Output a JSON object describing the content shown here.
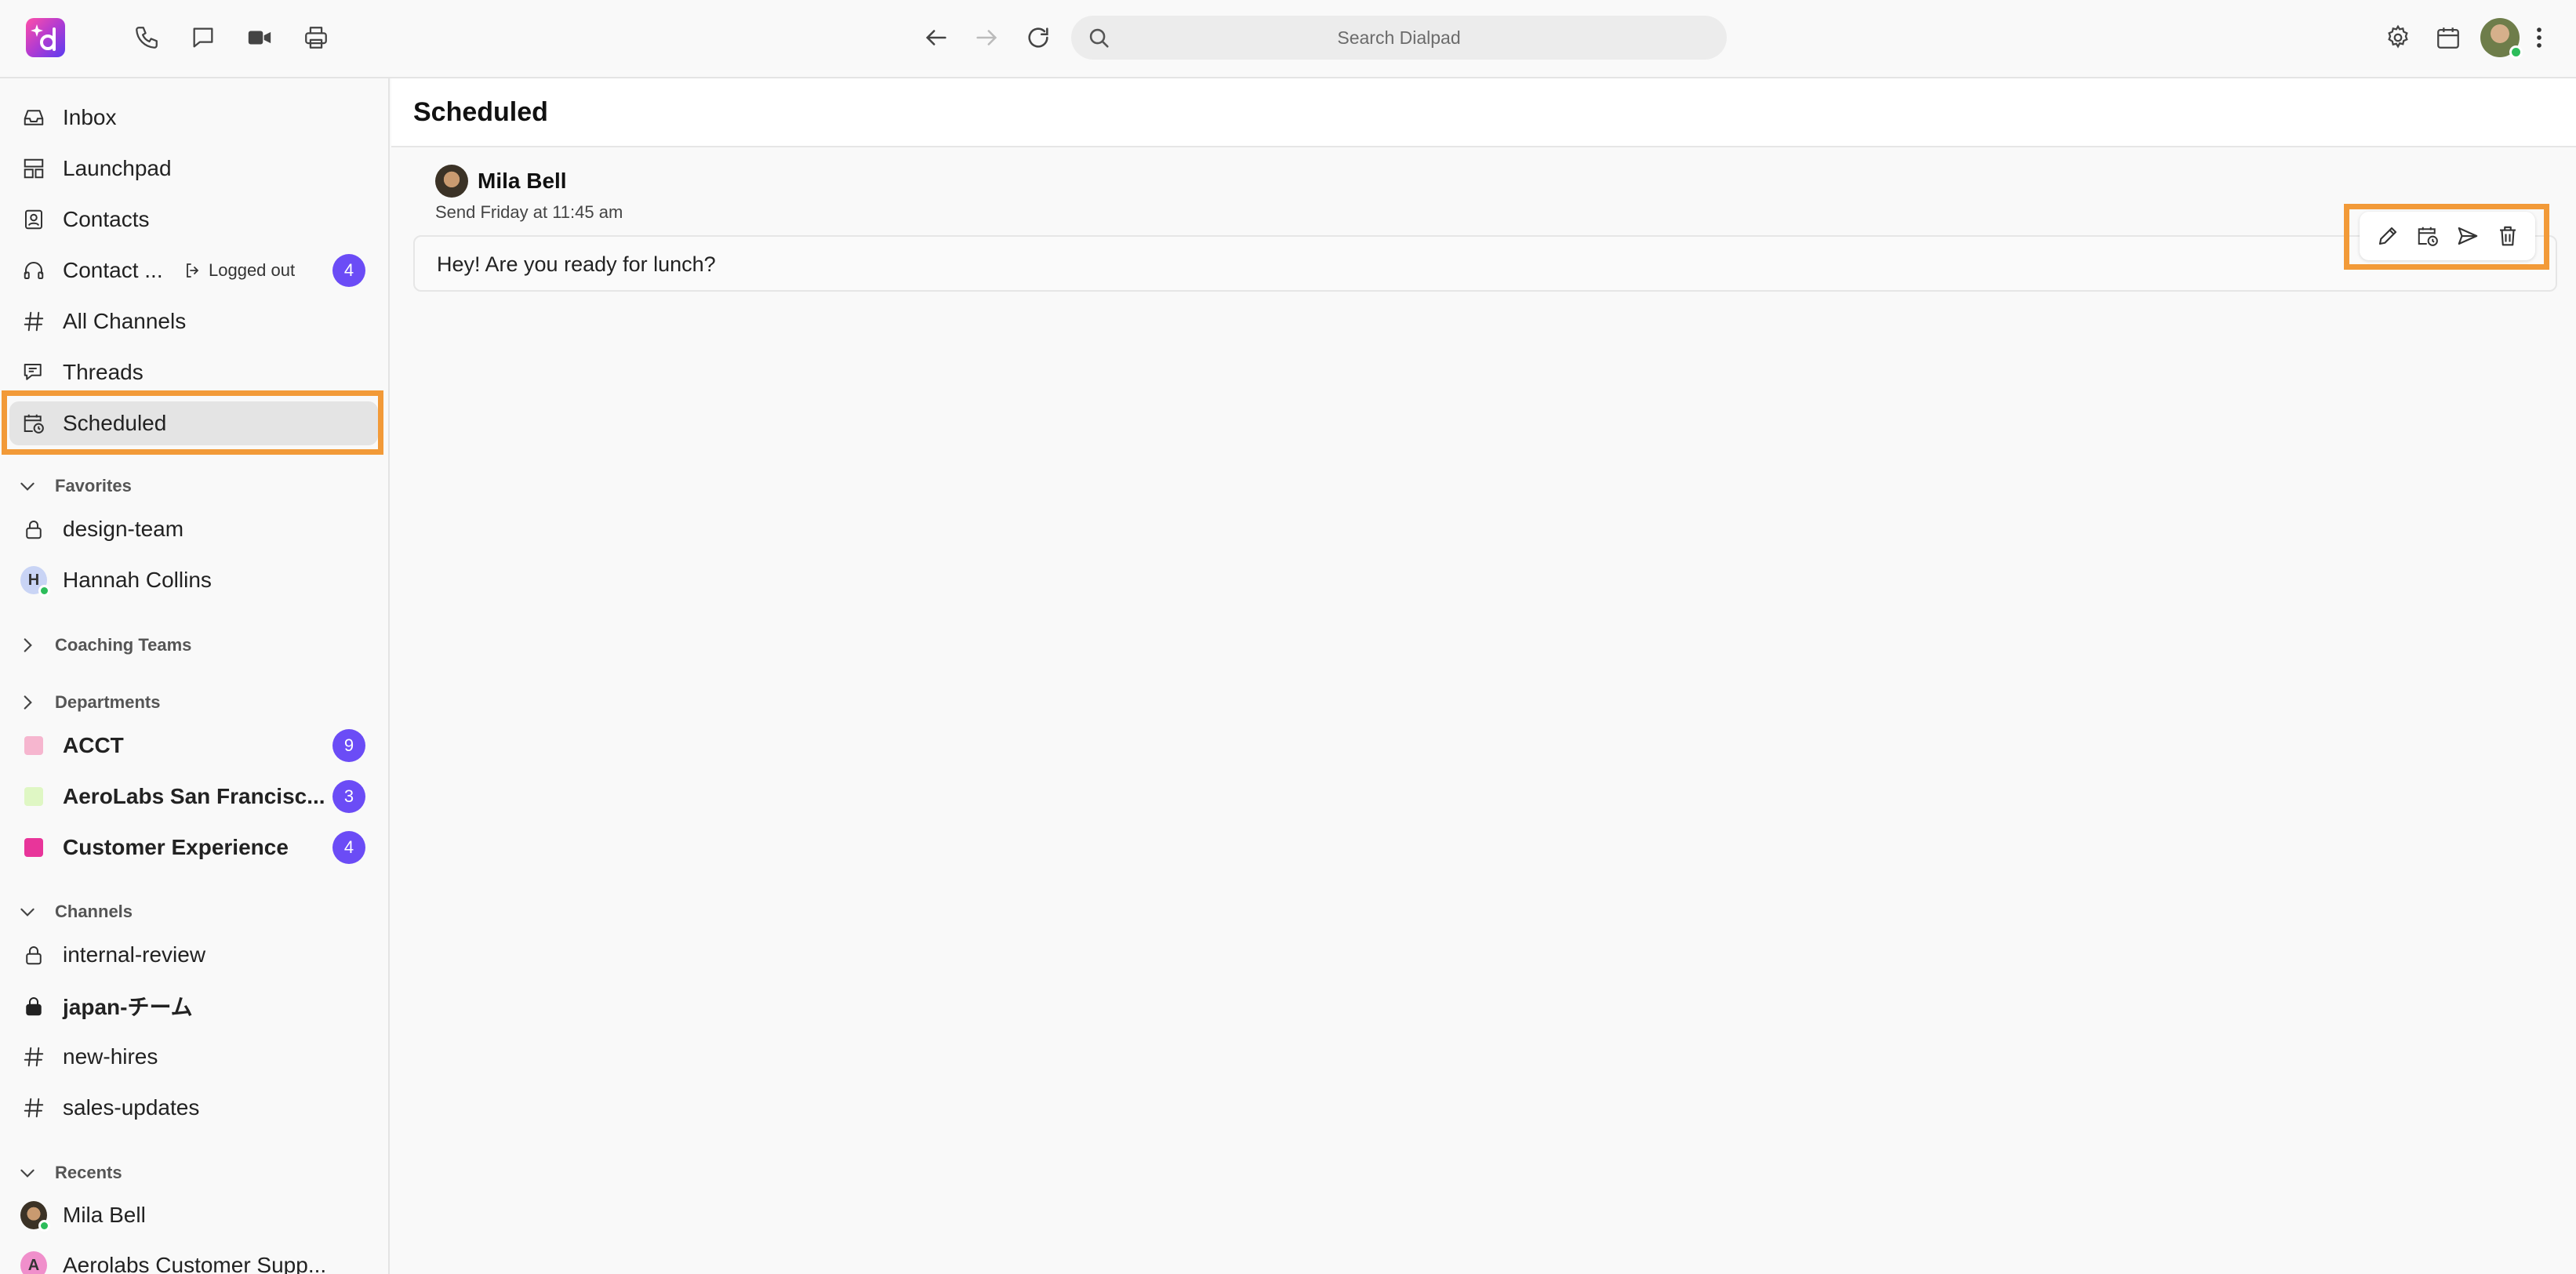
{
  "search": {
    "placeholder": "Search Dialpad"
  },
  "sidebar": {
    "items": [
      {
        "label": "Inbox"
      },
      {
        "label": "Launchpad"
      },
      {
        "label": "Contacts"
      },
      {
        "label": "Contact ...",
        "status": "Logged out",
        "badge": "4"
      },
      {
        "label": "All Channels"
      },
      {
        "label": "Threads"
      },
      {
        "label": "Scheduled"
      }
    ],
    "favorites": {
      "title": "Favorites",
      "items": [
        {
          "label": "design-team"
        },
        {
          "label": "Hannah Collins",
          "initial": "H"
        }
      ]
    },
    "coaching": {
      "title": "Coaching Teams"
    },
    "departments": {
      "title": "Departments",
      "items": [
        {
          "label": "ACCT",
          "badge": "9",
          "color": "#f6b6cf"
        },
        {
          "label": "AeroLabs San Francisc...",
          "badge": "3",
          "color": "#dff7c4"
        },
        {
          "label": "Customer Experience",
          "badge": "4",
          "color": "#e8359a"
        }
      ]
    },
    "channels": {
      "title": "Channels",
      "items": [
        {
          "label": "internal-review"
        },
        {
          "label": "japan-チーム"
        },
        {
          "label": "new-hires"
        },
        {
          "label": "sales-updates"
        }
      ]
    },
    "recents": {
      "title": "Recents",
      "items": [
        {
          "label": "Mila Bell"
        },
        {
          "label": "Aerolabs Customer Supp...",
          "initial": "A"
        }
      ]
    }
  },
  "main": {
    "title": "Scheduled",
    "message": {
      "sender": "Mila Bell",
      "send_time": "Send Friday at 11:45 am",
      "text": "Hey! Are you ready for lunch?"
    }
  },
  "colors": {
    "accent": "#6b4cf6",
    "highlight": "#f29a38",
    "online": "#2dbd5b"
  }
}
